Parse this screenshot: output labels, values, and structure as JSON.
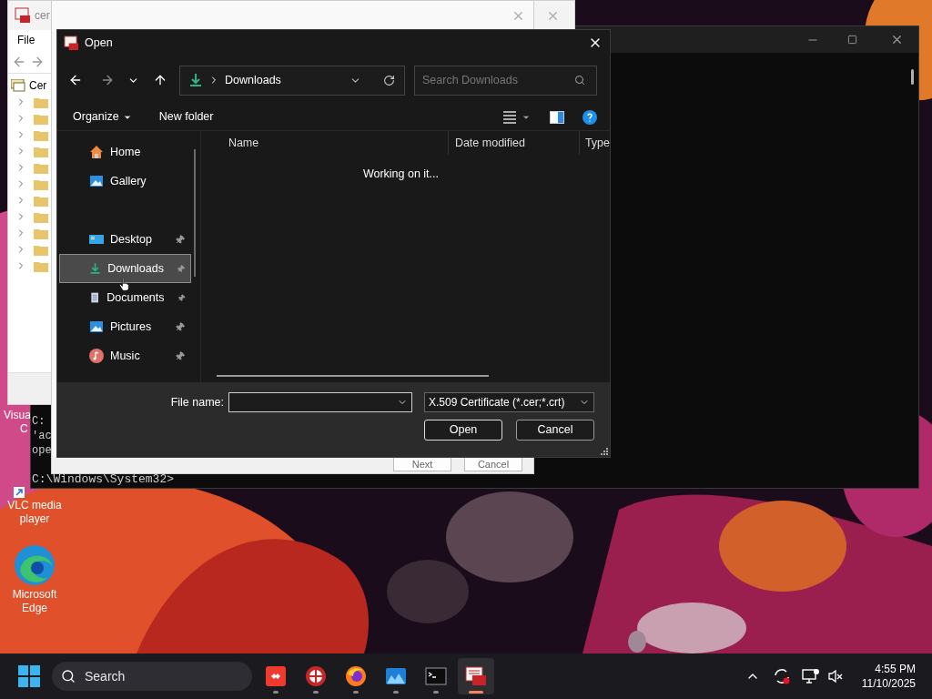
{
  "desktop_icons": [
    {
      "kind": "hidden",
      "lines": [
        "Visua",
        "C"
      ]
    },
    {
      "kind": "vlc",
      "lines": [
        "VLC media",
        "player"
      ]
    },
    {
      "kind": "edge",
      "lines": [
        "Microsoft",
        "Edge"
      ]
    }
  ],
  "console_window": {
    "lines": [
      "C:",
      "'ac",
      "ope"
    ],
    "prompt": "C:\\Windows\\System32>"
  },
  "cert_window": {
    "title": "cer",
    "menu": [
      "File"
    ],
    "tree_root": "Cer",
    "folders": [
      {
        "expanded": false
      },
      {
        "expanded": false
      },
      {
        "expanded": false
      },
      {
        "expanded": false
      },
      {
        "expanded": false
      },
      {
        "expanded": false
      },
      {
        "expanded": false
      },
      {
        "expanded": false
      },
      {
        "expanded": false
      },
      {
        "expanded": false
      },
      {
        "expanded": false
      }
    ]
  },
  "wizard_window": {
    "buttons": [
      "Next",
      "Cancel"
    ]
  },
  "dialog": {
    "title": "Open",
    "address": "Downloads",
    "search_placeholder": "Search Downloads",
    "organize": "Organize",
    "new_folder": "New folder",
    "nav_groups": [
      {
        "items": [
          {
            "kind": "home",
            "label": "Home",
            "selected": false,
            "pinned": false
          },
          {
            "kind": "gallery",
            "label": "Gallery",
            "selected": false,
            "pinned": false
          }
        ]
      },
      {
        "items": [
          {
            "kind": "desktop",
            "label": "Desktop",
            "selected": false,
            "pinned": true
          },
          {
            "kind": "downloads",
            "label": "Downloads",
            "selected": true,
            "pinned": true
          },
          {
            "kind": "documents",
            "label": "Documents",
            "selected": false,
            "pinned": true
          },
          {
            "kind": "pictures",
            "label": "Pictures",
            "selected": false,
            "pinned": true
          },
          {
            "kind": "music",
            "label": "Music",
            "selected": false,
            "pinned": true
          }
        ]
      }
    ],
    "columns": [
      "Name",
      "Date modified",
      "Type"
    ],
    "status": "Working on it...",
    "file_name_label": "File name:",
    "file_type": "X.509 Certificate (*.cer;*.crt)",
    "buttons": [
      "Open",
      "Cancel"
    ]
  },
  "taskbar": {
    "search": "Search",
    "apps": [
      {
        "kind": "remote",
        "selected": false
      },
      {
        "kind": "compass",
        "selected": false
      },
      {
        "kind": "browser",
        "selected": false
      },
      {
        "kind": "photos",
        "selected": false
      },
      {
        "kind": "terminal",
        "selected": false
      },
      {
        "kind": "certificate",
        "selected": true
      }
    ],
    "time": "4:55 PM",
    "date": "11/10/2025"
  }
}
